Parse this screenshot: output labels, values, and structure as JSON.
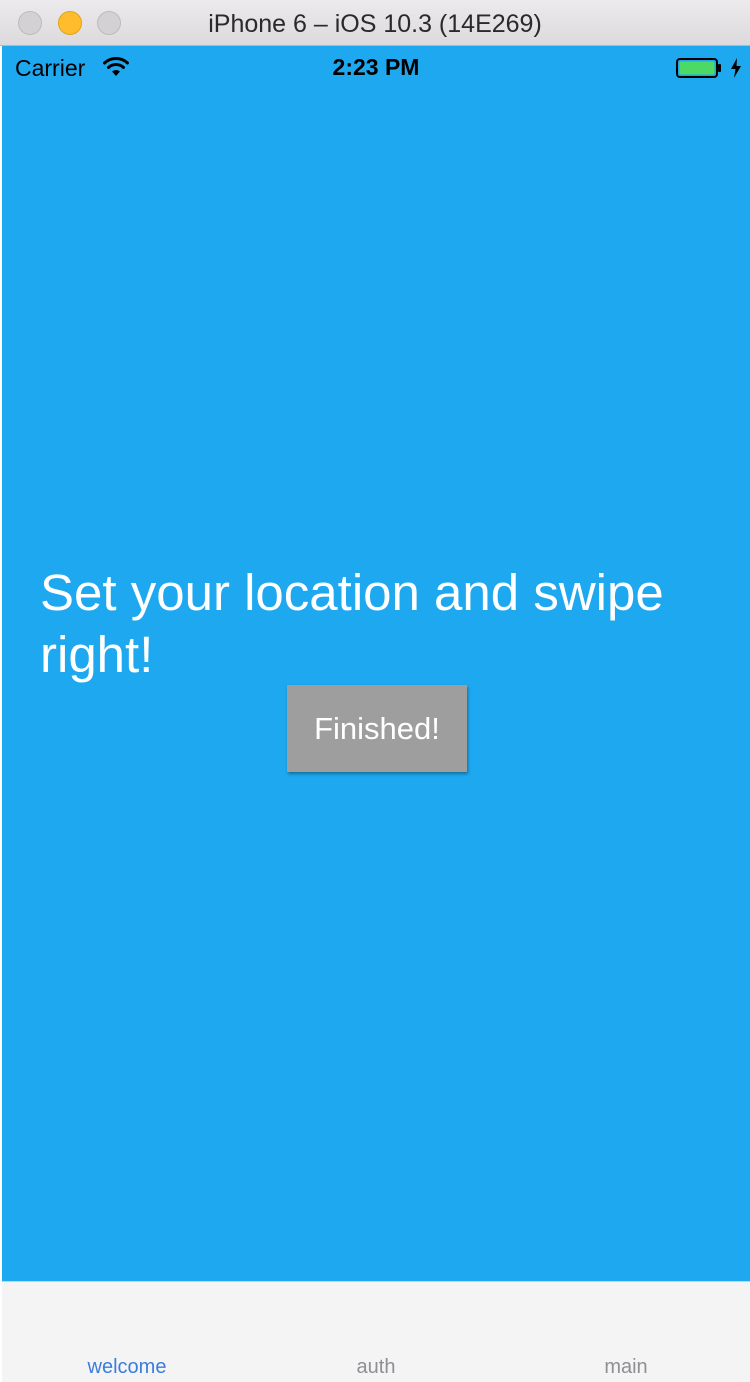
{
  "window": {
    "title": "iPhone 6 – iOS 10.3 (14E269)"
  },
  "status_bar": {
    "carrier": "Carrier",
    "time": "2:23 PM",
    "icons": [
      "wifi-icon",
      "battery-icon",
      "charging-bolt-icon"
    ]
  },
  "main": {
    "headline": "Set your location and swipe right!",
    "finish_button_label": "Finished!",
    "background_color": "#1ea8f0",
    "button_color": "#9e9e9e"
  },
  "tab_bar": {
    "tabs": [
      {
        "label": "welcome",
        "active": true
      },
      {
        "label": "auth",
        "active": false
      },
      {
        "label": "main",
        "active": false
      }
    ],
    "active_color": "#3a7ddc",
    "inactive_color": "#8e8e93"
  }
}
